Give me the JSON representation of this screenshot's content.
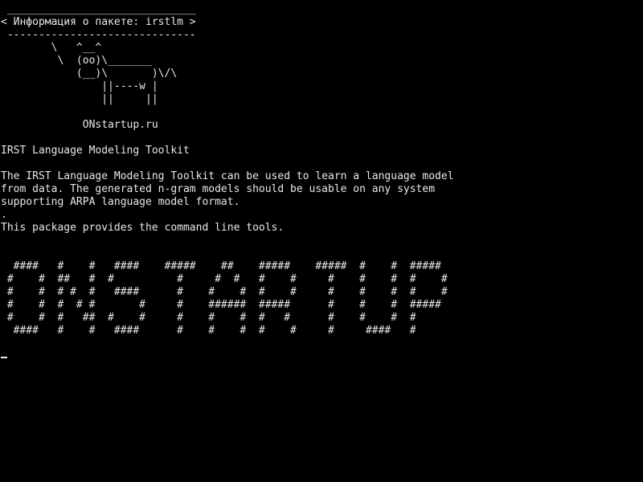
{
  "terminal": {
    "cowsay": [
      " ______________________________",
      "< Информация о пакете: irstlm >",
      " ------------------------------",
      "        \\   ^__^",
      "         \\  (oo)\\_______",
      "            (__)\\       )\\/\\",
      "                ||----w |",
      "                ||     ||"
    ],
    "site": "             ONstartup.ru",
    "package_title": "IRST Language Modeling Toolkit",
    "description": [
      "The IRST Language Modeling Toolkit can be used to learn a language model",
      "from data. The generated n-gram models should be usable on any system",
      "supporting ARPA language model format.",
      ".",
      "This package provides the command line tools."
    ],
    "banner": [
      "  ####   #    #   ####    #####    ##    #####    #####  #    #  #####",
      " #    #  ##   #  #          #     #  #   #    #     #    #    #  #    #",
      " #    #  # #  #   ####      #    #    #  #    #     #    #    #  #    #",
      " #    #  #  # #       #     #    ######  #####      #    #    #  #####",
      " #    #  #   ##  #    #     #    #    #  #   #      #    #    #  #",
      "  ####   #    #   ####      #    #    #  #    #     #     ####   #"
    ]
  }
}
